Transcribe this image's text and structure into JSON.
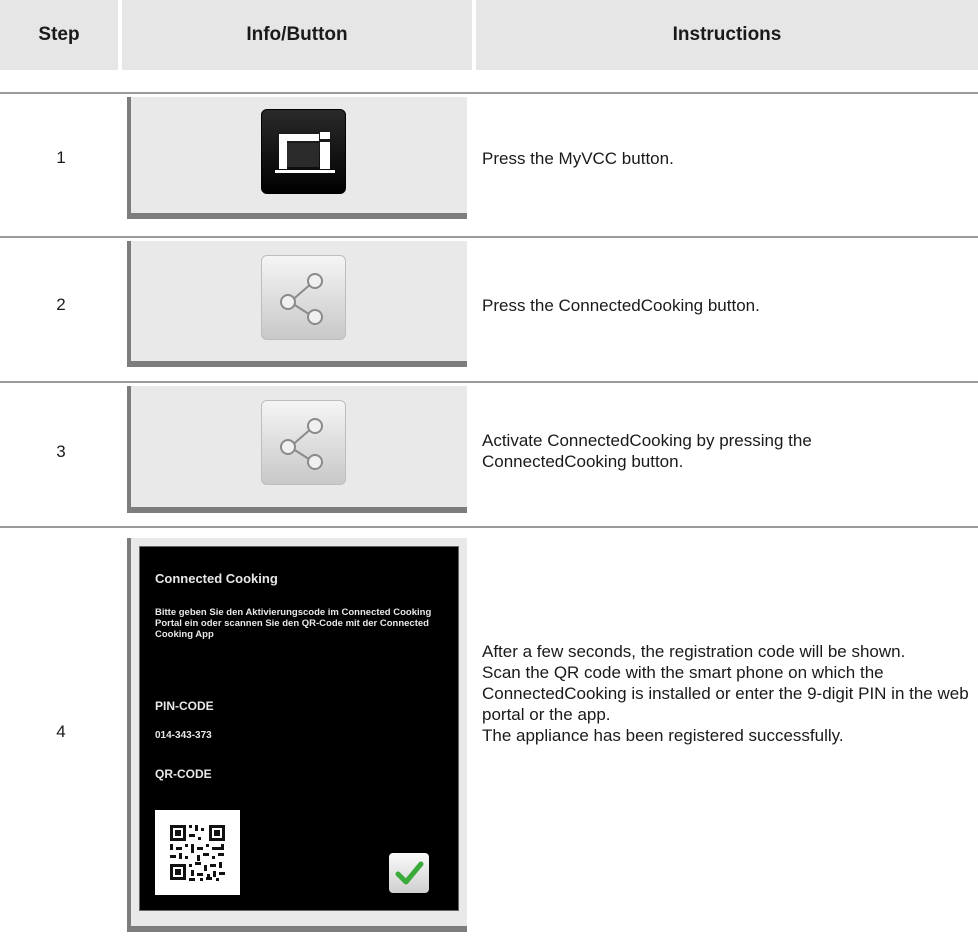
{
  "header": {
    "step": "Step",
    "info": "Info/Button",
    "instructions": "Instructions"
  },
  "steps": [
    {
      "number": "1",
      "icon": "myvcc-icon",
      "instruction": "Press the MyVCC button."
    },
    {
      "number": "2",
      "icon": "share-icon",
      "instruction": "Press the ConnectedCooking button."
    },
    {
      "number": "3",
      "icon": "share-icon",
      "instruction": "Activate ConnectedCooking by pressing the ConnectedCooking button."
    },
    {
      "number": "4",
      "icon": "device-screen",
      "instruction_lines": [
        "After a few seconds, the registration code will be shown.",
        "Scan the QR code with the smart phone on which the ConnectedCooking is installed or enter the 9-digit PIN in the web portal or the app.",
        "The appliance has been registered successfully."
      ]
    }
  ],
  "device_screen": {
    "title": "Connected Cooking",
    "description": "Bitte geben Sie den Aktivierungscode im Connected Cooking Portal ein oder scannen Sie den QR-Code mit der Connected Cooking App",
    "pin_label": "PIN-CODE",
    "pin_value": "014-343-373",
    "qr_label": "QR-CODE",
    "confirm_icon": "checkmark-icon"
  },
  "colors": {
    "header_bg": "#e6e6e6",
    "panel_bg": "#e9e9e9",
    "rule": "#9a9a9a",
    "check_green": "#3aaa3a"
  }
}
